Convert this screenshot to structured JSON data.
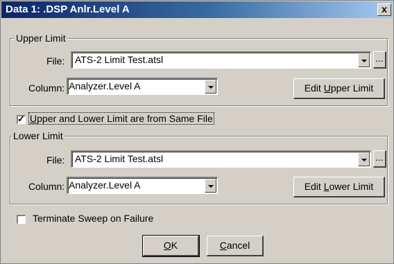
{
  "window": {
    "title": "Data 1: .DSP Anlr.Level A",
    "close_label": "x"
  },
  "upper_limit": {
    "group_label": "Upper Limit",
    "file_label": "File:",
    "file_value": "ATS-2 Limit Test.atsl",
    "browse_label": "...",
    "column_label": "Column:",
    "column_value": "Analyzer.Level A",
    "edit_pre": "Edit ",
    "edit_mnemonic": "U",
    "edit_post": "pper Limit"
  },
  "same_file": {
    "checked": true,
    "mark": "✓",
    "mnemonic": "U",
    "label_rest": "pper and Lower Limit are from Same File"
  },
  "lower_limit": {
    "group_label": "Lower Limit",
    "file_label": "File:",
    "file_value": "ATS-2 Limit Test.atsl",
    "browse_label": "...",
    "column_label": "Column:",
    "column_value": "Analyzer.Level A",
    "edit_pre": "Edit ",
    "edit_mnemonic": "L",
    "edit_post": "ower Limit"
  },
  "terminate": {
    "checked": false,
    "label": "Terminate Sweep on Failure"
  },
  "buttons": {
    "ok_mnemonic": "O",
    "ok_rest": "K",
    "cancel_mnemonic": "C",
    "cancel_rest": "ancel"
  }
}
